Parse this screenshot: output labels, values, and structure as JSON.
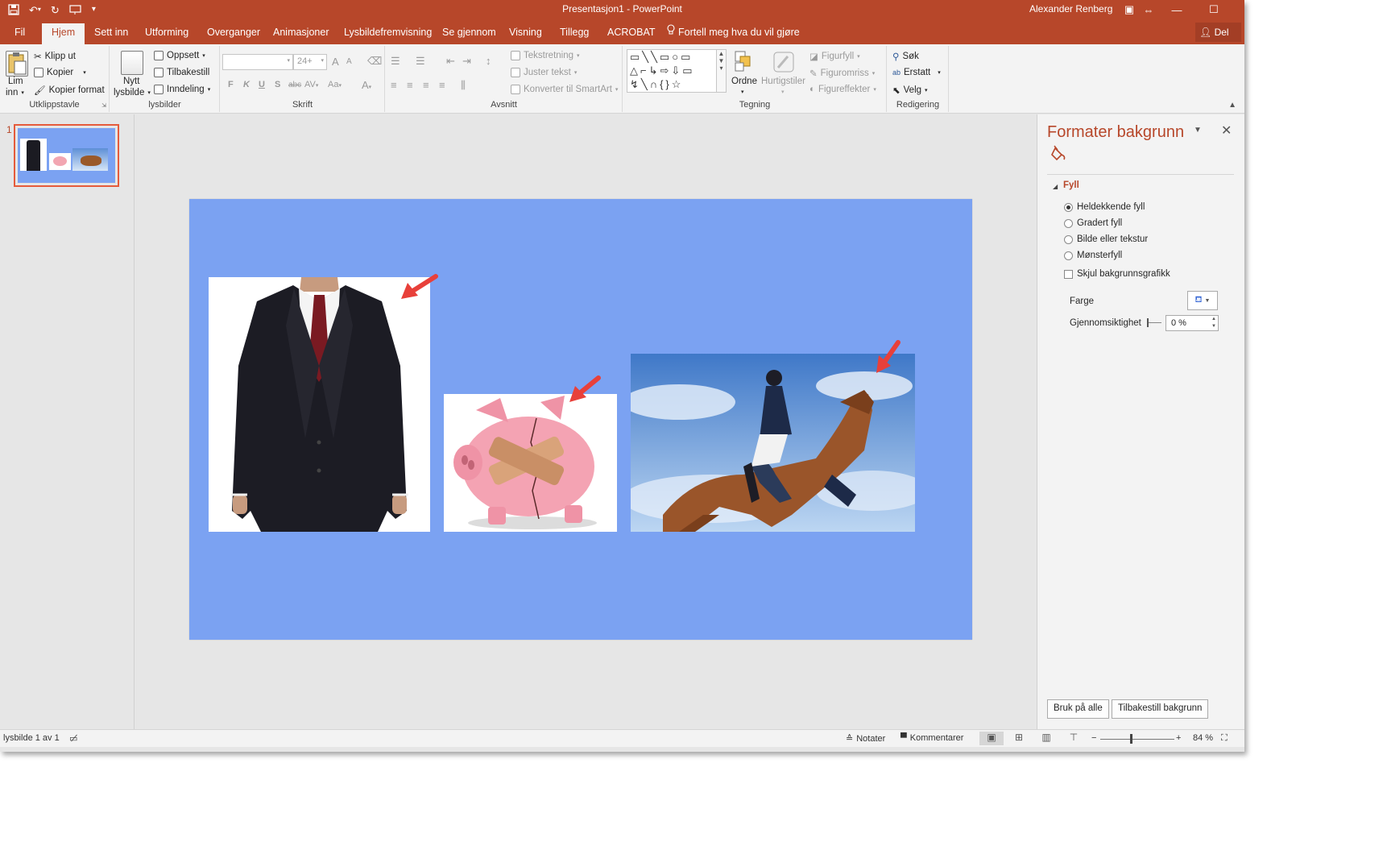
{
  "window": {
    "title": "Presentasjon1 - PowerPoint",
    "user": "Alexander Renberg"
  },
  "tabs": [
    {
      "label": "Fil"
    },
    {
      "label": "Hjem"
    },
    {
      "label": "Sett inn"
    },
    {
      "label": "Utforming"
    },
    {
      "label": "Overganger"
    },
    {
      "label": "Animasjoner"
    },
    {
      "label": "Lysbildefremvisning"
    },
    {
      "label": "Se gjennom"
    },
    {
      "label": "Visning"
    },
    {
      "label": "Tillegg"
    },
    {
      "label": "ACROBAT"
    },
    {
      "label": "Fortell meg hva du vil gjøre"
    }
  ],
  "share_label": "Del",
  "ribbon": {
    "clipboard": {
      "paste_line1": "Lim",
      "paste_line2": "inn",
      "cut": "Klipp ut",
      "copy": "Kopier",
      "format_painter": "Kopier format",
      "group": "Utklippstavle"
    },
    "slides": {
      "new_line1": "Nytt",
      "new_line2": "lysbilde",
      "layout": "Oppsett",
      "reset": "Tilbakestill",
      "section": "Inndeling",
      "group": "lysbilder"
    },
    "font": {
      "size": "24+",
      "bold": "F",
      "italic": "K",
      "underline": "U",
      "shadow": "S",
      "strike": "abc",
      "spacing": "AV",
      "case": "Aa",
      "color": "A",
      "grow": "A",
      "shrink": "A",
      "group": "Skrift"
    },
    "paragraph": {
      "text_direction": "Tekstretning",
      "align_text": "Juster tekst",
      "smartart": "Konverter til SmartArt",
      "group": "Avsnitt"
    },
    "drawing": {
      "arrange": "Ordne",
      "quick_styles": "Hurtigstiler",
      "shape_fill": "Figurfyll",
      "shape_outline": "Figuromriss",
      "shape_effects": "Figureffekter",
      "group": "Tegning"
    },
    "editing": {
      "find": "Søk",
      "replace": "Erstatt",
      "select": "Velg",
      "group": "Redigering"
    }
  },
  "thumbnail": {
    "number": "1"
  },
  "format_pane": {
    "title": "Formater bakgrunn",
    "section": "Fyll",
    "options": [
      {
        "label": "Heldekkende fyll",
        "selected": true
      },
      {
        "label": "Gradert fyll",
        "selected": false
      },
      {
        "label": "Bilde eller tekstur",
        "selected": false
      },
      {
        "label": "Mønsterfyll",
        "selected": false
      }
    ],
    "hide_graphics": "Skjul bakgrunnsgrafikk",
    "color_label": "Farge",
    "transparency_label": "Gjennomsiktighet",
    "transparency_value": "0 %",
    "apply_all": "Bruk på alle",
    "reset_background": "Tilbakestill bakgrunn"
  },
  "statusbar": {
    "slide_info": "lysbilde 1 av 1",
    "notes": "Notater",
    "comments": "Kommentarer",
    "zoom": "84 %",
    "zoom_minus": "−",
    "zoom_plus": "+"
  },
  "colors": {
    "accent": "#b7472a",
    "slide_background": "#7ba2f2",
    "arrow": "#e8403a"
  }
}
